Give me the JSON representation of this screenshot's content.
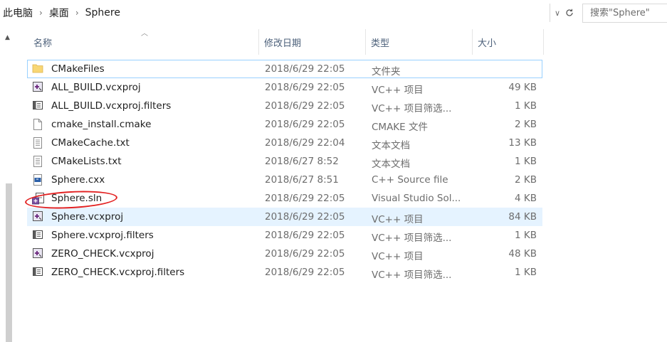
{
  "breadcrumb": [
    "此电脑",
    "桌面",
    "Sphere"
  ],
  "breadcrumb_separator": "›",
  "search": {
    "placeholder": "搜索\"Sphere\""
  },
  "columns": {
    "name": "名称",
    "date": "修改日期",
    "type": "类型",
    "size": "大小"
  },
  "files": [
    {
      "name": "CMakeFiles",
      "date": "2018/6/29 22:05",
      "type": "文件夹",
      "size": "",
      "icon": "folder-icon"
    },
    {
      "name": "ALL_BUILD.vcxproj",
      "date": "2018/6/29 22:05",
      "type": "VC++ 项目",
      "size": "49 KB",
      "icon": "vcxproj-icon"
    },
    {
      "name": "ALL_BUILD.vcxproj.filters",
      "date": "2018/6/29 22:05",
      "type": "VC++ 项目筛选...",
      "size": "1 KB",
      "icon": "filters-icon"
    },
    {
      "name": "cmake_install.cmake",
      "date": "2018/6/29 22:05",
      "type": "CMAKE 文件",
      "size": "2 KB",
      "icon": "blank-file-icon"
    },
    {
      "name": "CMakeCache.txt",
      "date": "2018/6/29 22:04",
      "type": "文本文档",
      "size": "13 KB",
      "icon": "text-file-icon"
    },
    {
      "name": "CMakeLists.txt",
      "date": "2018/6/27 8:52",
      "type": "文本文档",
      "size": "1 KB",
      "icon": "text-file-icon"
    },
    {
      "name": "Sphere.cxx",
      "date": "2018/6/27 8:51",
      "type": "C++ Source file",
      "size": "2 KB",
      "icon": "cpp-file-icon"
    },
    {
      "name": "Sphere.sln",
      "date": "2018/6/29 22:05",
      "type": "Visual Studio Sol...",
      "size": "4 KB",
      "icon": "sln-icon"
    },
    {
      "name": "Sphere.vcxproj",
      "date": "2018/6/29 22:05",
      "type": "VC++ 项目",
      "size": "84 KB",
      "icon": "vcxproj-icon"
    },
    {
      "name": "Sphere.vcxproj.filters",
      "date": "2018/6/29 22:05",
      "type": "VC++ 项目筛选...",
      "size": "1 KB",
      "icon": "filters-icon"
    },
    {
      "name": "ZERO_CHECK.vcxproj",
      "date": "2018/6/29 22:05",
      "type": "VC++ 项目",
      "size": "48 KB",
      "icon": "vcxproj-icon"
    },
    {
      "name": "ZERO_CHECK.vcxproj.filters",
      "date": "2018/6/29 22:05",
      "type": "VC++ 项目筛选...",
      "size": "1 KB",
      "icon": "filters-icon"
    }
  ],
  "colors": {
    "selection": "#e5f3ff",
    "selection_border": "#99d1ff",
    "annotation": "#e32222",
    "header_text": "#4c607a"
  }
}
